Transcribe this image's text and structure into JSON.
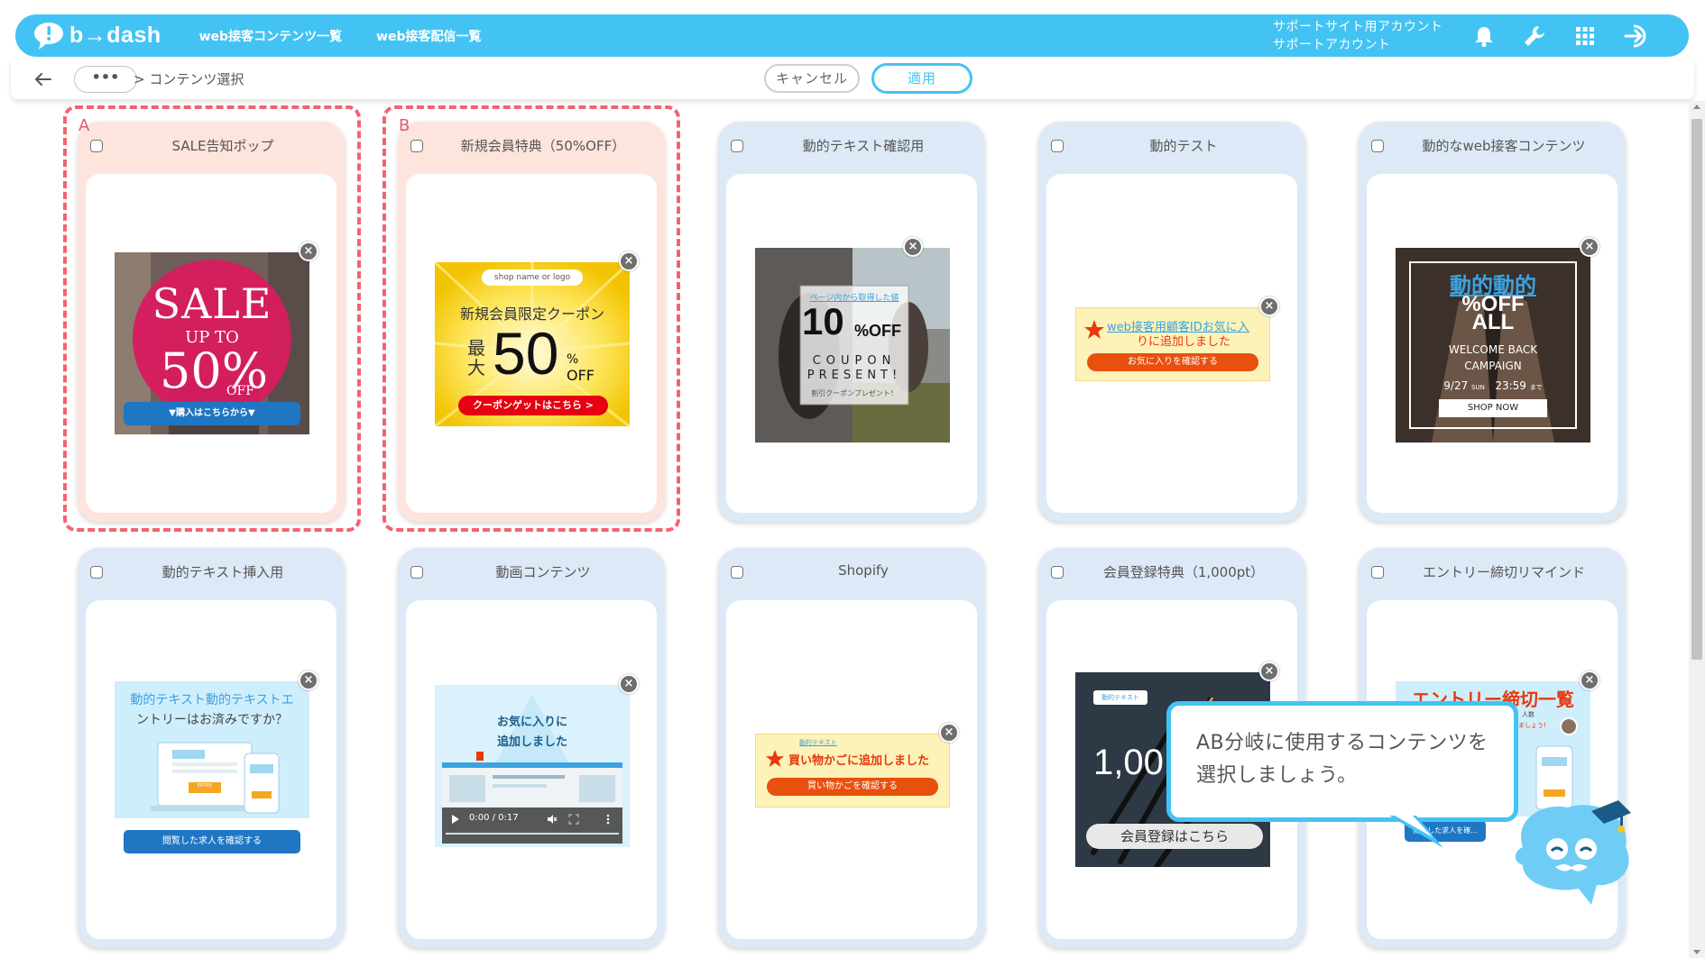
{
  "header": {
    "logo_text": "b→dash",
    "nav": [
      "web接客コンテンツ一覧",
      "web接客配信一覧"
    ],
    "account_line1": "サポートサイト用アカウント",
    "account_line2": "サポートアカウント",
    "brand_color": "#43c3f3",
    "icons": [
      "bell-icon",
      "wrench-icon",
      "grid-icon",
      "logout-icon"
    ]
  },
  "subheader": {
    "more_label": "•••",
    "breadcrumb": "> コンテンツ選択",
    "cancel_label": "キャンセル",
    "apply_label": "適用"
  },
  "ab": {
    "a": "A",
    "b": "B"
  },
  "cards": [
    {
      "title": "SALE告知ポップ",
      "selected": true
    },
    {
      "title": "新規会員特典（50%OFF）",
      "selected": true
    },
    {
      "title": "動的テキスト確認用",
      "selected": false
    },
    {
      "title": "動的テスト",
      "selected": false
    },
    {
      "title": "動的なweb接客コンテンツ",
      "selected": false
    },
    {
      "title": "動的テキスト挿入用",
      "selected": false
    },
    {
      "title": "動画コンテンツ",
      "selected": false
    },
    {
      "title": "Shopify",
      "selected": false
    },
    {
      "title": "会員登録特典（1,000pt）",
      "selected": false
    },
    {
      "title": "エントリー締切リマインド",
      "selected": false
    }
  ],
  "banners": {
    "sale": {
      "big": "SALE",
      "upto": "UP TO",
      "pct": "50%",
      "off": "OFF",
      "button": "▼購入はこちらから▼"
    },
    "coupon50": {
      "shop": "shop name or logo",
      "headline": "新規会員限定クーポン",
      "max": "最大",
      "num": "50",
      "pct": "%",
      "off": "OFF",
      "button": "クーポンゲットはこちら >"
    },
    "dyn_text": {
      "caption": "ページ内から取得した値",
      "num": "10",
      "pct": "%OFF",
      "coupon": "COUPON",
      "present": "PRESENT!",
      "note": "割引クーポンプレゼント！"
    },
    "dyn_test": {
      "line1": "web接客用顧客IDお気に入",
      "line2": "りに追加しました",
      "button": "お気に入りを確認する"
    },
    "dyn_web": {
      "title": "動的動的",
      "off": "%OFF",
      "all": "ALL",
      "welcome": "WELCOME BACK",
      "campaign": "CAMPAIGN",
      "date": "9/27",
      "dow": "SUN",
      "time": "23:59",
      "until": "まで",
      "button": "SHOP NOW"
    },
    "insert": {
      "line1": "動的テキスト動的テキストエ",
      "line2": "ントリーはお済みですか？",
      "screen_btn": "ENTRY",
      "button": "閲覧した求人を確認する"
    },
    "video": {
      "line1": "お気に入りに",
      "line2": "追加しました",
      "time": "0:00 / 0:17"
    },
    "shopify": {
      "small": "動的テキスト",
      "line": "買い物かごに追加しました",
      "button": "買い物かごを確認する"
    },
    "member": {
      "small": "動的テキスト",
      "num": "1,00",
      "button": "会員登録はこちら"
    },
    "entry": {
      "title": "エントリー締切一覧",
      "sub": "人数",
      "pill": "ましょう!",
      "button": "閲覧した求人を確..."
    }
  },
  "tooltip": {
    "line1": "AB分岐に使用するコンテンツを",
    "line2": "選択しましょう。"
  }
}
